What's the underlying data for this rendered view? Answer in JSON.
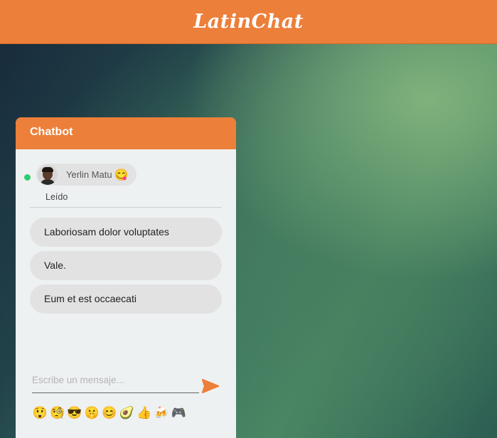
{
  "app": {
    "brand": "LatinChat"
  },
  "chat": {
    "title": "Chatbot",
    "contact": {
      "name": "Yerlin Matu",
      "emoji": "😋",
      "status": "online",
      "status_color": "#2ecc71"
    },
    "read_label": "Leído",
    "messages": [
      {
        "text": "Laboriosam dolor voluptates"
      },
      {
        "text": "Vale."
      },
      {
        "text": "Eum et est occaecati"
      }
    ],
    "composer": {
      "placeholder": "Escribe un mensaje...",
      "value": ""
    },
    "emoji_bar": [
      "😲",
      "🧐",
      "😎",
      "🤫",
      "😊",
      "🥑",
      "👍",
      "🍻",
      "🎮"
    ]
  },
  "colors": {
    "accent": "#ec7f3a",
    "panel": "#eef1f2",
    "bubble": "#e2e2e2"
  },
  "icons": {
    "send": "send-icon"
  }
}
